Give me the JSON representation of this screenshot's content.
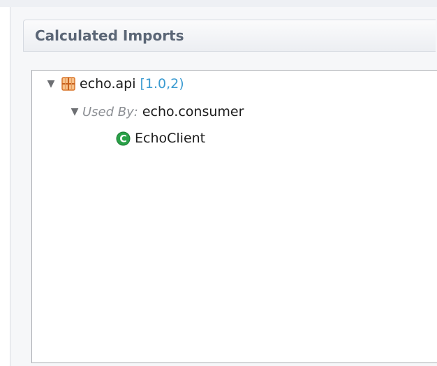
{
  "section": {
    "title": "Calculated Imports"
  },
  "tree": {
    "package": {
      "name": "echo.api",
      "version_range": "[1.0,2)",
      "icon": "package-icon"
    },
    "used_by": {
      "label": "Used By:",
      "bundle": "echo.consumer"
    },
    "class": {
      "name": "EchoClient",
      "icon": "class-icon"
    }
  },
  "colors": {
    "range_blue": "#3b9bd1",
    "package_orange": "#e9873a",
    "class_green": "#2aa148",
    "header_text": "#5b6676"
  }
}
